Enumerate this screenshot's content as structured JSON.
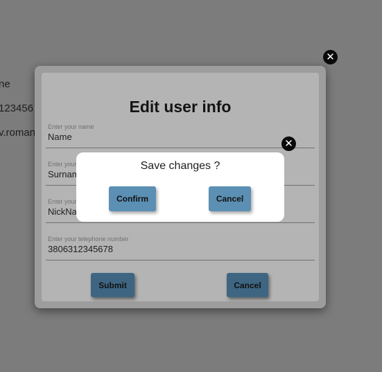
{
  "background": {
    "lines": [
      "ne",
      "123456",
      "v.roman"
    ]
  },
  "edit_modal": {
    "title": "Edit user info",
    "fields": [
      {
        "label": "Enter your name",
        "value": "Name"
      },
      {
        "label": "Enter your surname",
        "value": "Surname"
      },
      {
        "label": "Enter your nickname",
        "value": "NickName"
      },
      {
        "label": "Enter your telephone number",
        "value": "3806312345678"
      }
    ],
    "submit_label": "Submit",
    "cancel_label": "Cancel"
  },
  "confirm_dialog": {
    "message": "Save changes ?",
    "confirm_label": "Confirm",
    "cancel_label": "Cancel"
  },
  "icons": {
    "close": "✕"
  },
  "colors": {
    "overlay": "#7c7c7c",
    "modal_frame": "#9d9d9d",
    "modal_inner": "#b4b4b4",
    "button_dimmed": "#3e6682",
    "button_active": "#5b8fb3",
    "dialog": "#ffffff"
  }
}
